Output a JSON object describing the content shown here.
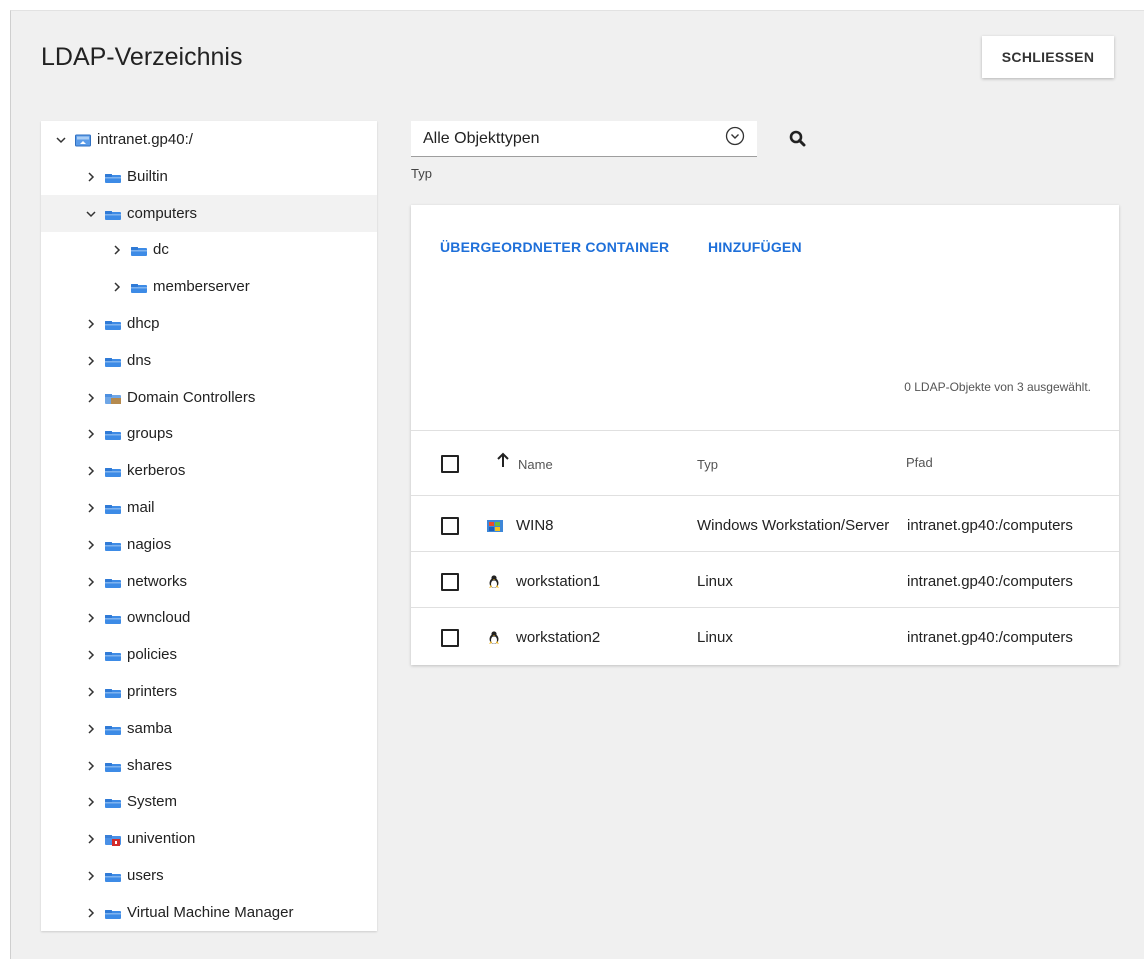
{
  "dialog": {
    "title": "LDAP-Verzeichnis",
    "close_label": "SCHLIESSEN"
  },
  "tree": {
    "root": "intranet.gp40:/",
    "items": [
      {
        "label": "Builtin",
        "icon": "folder-icon",
        "expanded": false
      },
      {
        "label": "computers",
        "icon": "folder-icon",
        "expanded": true,
        "selected": true
      },
      {
        "label": "dc",
        "icon": "folder-icon",
        "expanded": false,
        "child": true
      },
      {
        "label": "memberserver",
        "icon": "folder-icon",
        "expanded": false,
        "child": true
      },
      {
        "label": "dhcp",
        "icon": "folder-icon",
        "expanded": false
      },
      {
        "label": "dns",
        "icon": "folder-icon",
        "expanded": false
      },
      {
        "label": "Domain Controllers",
        "icon": "domain-controllers-icon",
        "expanded": false
      },
      {
        "label": "groups",
        "icon": "folder-icon",
        "expanded": false
      },
      {
        "label": "kerberos",
        "icon": "folder-icon",
        "expanded": false
      },
      {
        "label": "mail",
        "icon": "folder-icon",
        "expanded": false
      },
      {
        "label": "nagios",
        "icon": "folder-icon",
        "expanded": false
      },
      {
        "label": "networks",
        "icon": "folder-icon",
        "expanded": false
      },
      {
        "label": "owncloud",
        "icon": "folder-icon",
        "expanded": false
      },
      {
        "label": "policies",
        "icon": "folder-icon",
        "expanded": false
      },
      {
        "label": "printers",
        "icon": "folder-icon",
        "expanded": false
      },
      {
        "label": "samba",
        "icon": "folder-icon",
        "expanded": false
      },
      {
        "label": "shares",
        "icon": "folder-icon",
        "expanded": false
      },
      {
        "label": "System",
        "icon": "folder-icon",
        "expanded": false
      },
      {
        "label": "univention",
        "icon": "univention-folder-icon",
        "expanded": false
      },
      {
        "label": "users",
        "icon": "folder-icon",
        "expanded": false
      },
      {
        "label": "Virtual Machine Manager",
        "icon": "folder-icon",
        "expanded": false
      }
    ]
  },
  "filter": {
    "type_value": "Alle Objekttypen",
    "type_label": "Typ"
  },
  "grid": {
    "actions": [
      "ÜBERGEORDNETER CONTAINER",
      "HINZUFÜGEN"
    ],
    "status": "0 LDAP-Objekte von 3 ausgewählt.",
    "columns": [
      "Name",
      "Typ",
      "Pfad"
    ],
    "rows": [
      {
        "name": "WIN8",
        "type": "Windows Workstation/Server",
        "path": "intranet.gp40:/computers",
        "icon": "windows-icon"
      },
      {
        "name": "workstation1",
        "type": "Linux",
        "path": "intranet.gp40:/computers",
        "icon": "linux-icon"
      },
      {
        "name": "workstation2",
        "type": "Linux",
        "path": "intranet.gp40:/computers",
        "icon": "linux-icon"
      }
    ]
  },
  "colors": {
    "accent": "#1e6fd9",
    "folder": "#3d8be6",
    "background": "#f0f0f0"
  }
}
